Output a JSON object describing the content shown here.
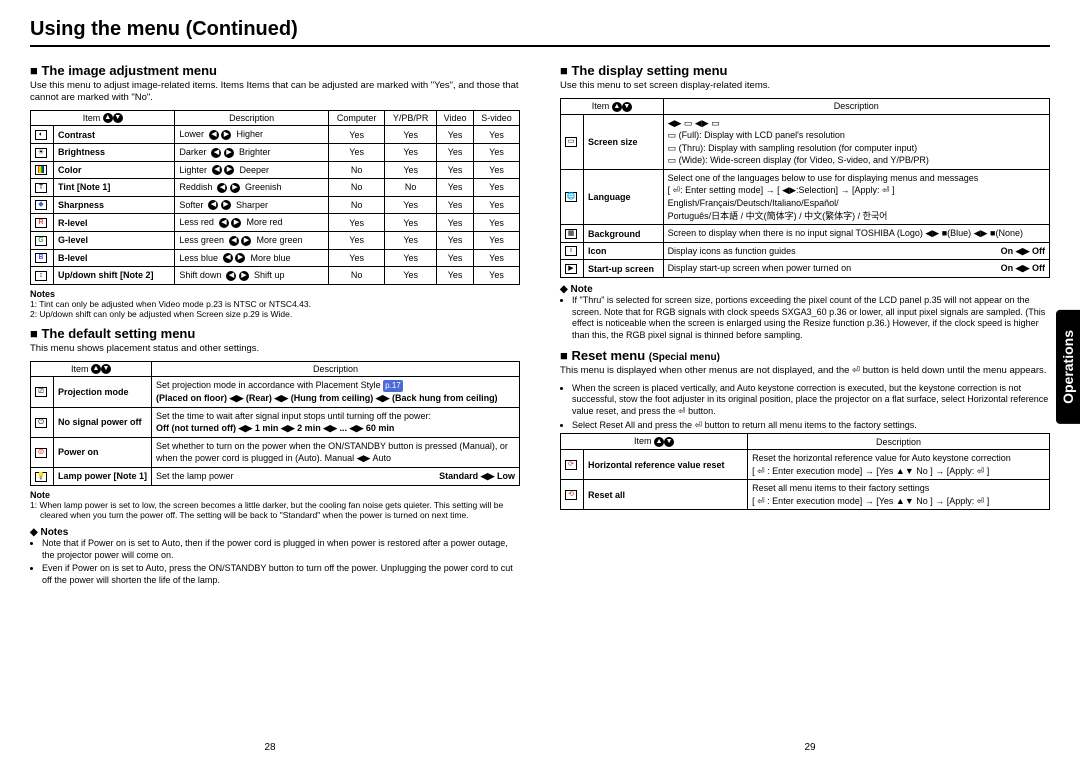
{
  "top_title": "Using the menu (Continued)",
  "left": {
    "image_menu": {
      "title": "■ The image adjustment menu",
      "intro": "Use this menu to adjust image-related items.\nItems Items that can be adjusted are marked with \"Yes\", and those that cannot are marked with \"No\".",
      "header": {
        "item": "Item",
        "desc": "Description",
        "c1": "Computer",
        "c2": "Y/PB/PR",
        "c3": "Video",
        "c4": "S-video"
      },
      "rows": [
        {
          "icon": "moon",
          "name": "Contrast",
          "left": "Lower",
          "right": "Higher",
          "c": [
            "Yes",
            "Yes",
            "Yes",
            "Yes"
          ]
        },
        {
          "icon": "sun",
          "name": "Brightness",
          "left": "Darker",
          "right": "Brighter",
          "c": [
            "Yes",
            "Yes",
            "Yes",
            "Yes"
          ]
        },
        {
          "icon": "pal",
          "name": "Color",
          "left": "Lighter",
          "right": "Deeper",
          "c": [
            "No",
            "Yes",
            "Yes",
            "Yes"
          ]
        },
        {
          "icon": "tint",
          "name": "Tint [Note 1]",
          "left": "Reddish",
          "right": "Greenish",
          "c": [
            "No",
            "No",
            "Yes",
            "Yes"
          ]
        },
        {
          "icon": "sharp",
          "name": "Sharpness",
          "left": "Softer",
          "right": "Sharper",
          "c": [
            "No",
            "Yes",
            "Yes",
            "Yes"
          ]
        },
        {
          "icon": "rl",
          "name": "R-level",
          "left": "Less red",
          "right": "More red",
          "c": [
            "Yes",
            "Yes",
            "Yes",
            "Yes"
          ]
        },
        {
          "icon": "gl",
          "name": "G-level",
          "left": "Less green",
          "right": "More green",
          "c": [
            "Yes",
            "Yes",
            "Yes",
            "Yes"
          ]
        },
        {
          "icon": "bl",
          "name": "B-level",
          "left": "Less blue",
          "right": "More blue",
          "c": [
            "Yes",
            "Yes",
            "Yes",
            "Yes"
          ]
        },
        {
          "icon": "ud",
          "name": "Up/down shift [Note 2]",
          "left": "Shift down",
          "right": "Shift up",
          "c": [
            "No",
            "Yes",
            "Yes",
            "Yes"
          ]
        }
      ],
      "notes_h": "Notes",
      "notes": [
        "1: Tint can only be adjusted when Video mode p.23 is NTSC or NTSC4.43.",
        "2: Up/down shift can only be adjusted when Screen size p.29 is Wide."
      ]
    },
    "default_menu": {
      "title": "■ The default setting menu",
      "intro": "This menu shows placement status and other settings.",
      "header": {
        "item": "Item",
        "desc": "Description"
      },
      "rows": [
        {
          "icon": "proj",
          "name": "Projection mode",
          "desc": "Set projection mode in accordance with Placement Style ",
          "pref": "p.17",
          "line2": "(Placed on floor) ◀▶ (Rear) ◀▶ (Hung from ceiling) ◀▶ (Back hung from ceiling)"
        },
        {
          "icon": "nosig",
          "name": "No signal power off",
          "desc": "Set the time to wait after signal input stops until turning off the power:",
          "line2": "Off (not turned off) ◀▶ 1 min ◀▶ 2 min ◀▶ ... ◀▶ 60 min"
        },
        {
          "icon": "pwr",
          "name": "Power on",
          "desc": "Set whether to turn on the power when the ON/STANDBY button is pressed (Manual), or when the power cord is plugged in (Auto).    Manual ◀▶ Auto"
        },
        {
          "icon": "lamp",
          "name": "Lamp power [Note 1]",
          "desc": "Set the lamp power",
          "right": "Standard ◀▶ Low"
        }
      ],
      "note_h": "Note",
      "note": "1: When lamp power is set to low, the screen becomes a little darker, but the cooling fan noise gets quieter. This setting will be cleared when you turn the power off. The setting will be back to \"Standard\" when the power is turned on next time.",
      "notes2_h": "◆ Notes",
      "notes2": [
        "Note that if Power on is set to Auto, then if the power cord is plugged in when power is restored after a power outage, the projector power will come on.",
        "Even if Power on is set to Auto, press the ON/STANDBY button to turn off the power. Unplugging the power cord to cut off the power will shorten the life of the lamp."
      ]
    },
    "page": "28"
  },
  "right": {
    "display_menu": {
      "title": "■ The display setting menu",
      "intro": "Use this menu to set screen display-related items.",
      "header": {
        "item": "Item",
        "desc": "Description"
      },
      "rows": [
        {
          "icon": "scr",
          "name": "Screen size",
          "desc_lines": [
            "▭ (Full):  Display with LCD panel's resolution",
            "▭ (Thru): Display with sampling resolution (for computer input)",
            "▭ (Wide):  Wide-screen display (for Video, S-video, and Y/PB/PR)"
          ],
          "top_icons": "◀▶ ▭ ◀▶ ▭"
        },
        {
          "icon": "lang",
          "name": "Language",
          "desc": "Select one of the languages below to use for displaying menus and messages",
          "line2": "[ ⏎: Enter setting mode] → [ ◀▶:Selection] → [Apply: ⏎ ]",
          "line3": "English/Français/Deutsch/Italiano/Español/",
          "line4": "Português/日本語 / 中文(簡体字) / 中文(繁体字) / 한국어"
        },
        {
          "icon": "bg",
          "name": "Background",
          "desc": "Screen to display when there is no input signal  TOSHIBA (Logo) ◀▶ ■(Blue) ◀▶ ■(None)"
        },
        {
          "icon": "icon",
          "name": "Icon",
          "desc": "Display icons as function guides",
          "right": "On ◀▶ Off"
        },
        {
          "icon": "start",
          "name": "Start-up screen",
          "desc": "Display start-up screen when power turned on",
          "right": "On ◀▶ Off"
        }
      ],
      "note_h": "◆ Note",
      "note": "If \"Thru\" is selected for screen size, portions exceeding the pixel count of the LCD panel p.35 will not appear on the screen. Note that for RGB signals with clock speeds SXGA3_60 p.36 or lower, all input pixel signals are sampled. (This effect is noticeable when the screen is enlarged using the Resize function p.36.) However, if the clock speed is higher than this, the RGB pixel signal is thinned before sampling."
    },
    "reset_menu": {
      "title": "■ Reset menu ",
      "title_small": "(Special menu)",
      "intro": "This menu is displayed when other menus are not displayed, and the ⏎ button is held down until the menu appears.",
      "bullets": [
        "When the screen is placed vertically, and Auto keystone correction is executed, but the keystone correction is not successful, stow the foot adjuster in its original position, place the projector on a flat surface, select Horizontal reference value reset, and press the ⏎ button.",
        "Select Reset All and press the ⏎ button to return all menu items to the factory settings."
      ],
      "header": {
        "item": "Item",
        "desc": "Description"
      },
      "rows": [
        {
          "icon": "hrz",
          "name": "Horizontal reference value reset",
          "desc": "Reset the horizontal reference value for Auto keystone correction",
          "line2": "[ ⏎ : Enter execution mode] → [Yes ▲▼ No ] → [Apply: ⏎ ]"
        },
        {
          "icon": "rst",
          "name": "Reset all",
          "desc": "Reset all menu items to their factory settings",
          "line2": "[ ⏎ : Enter execution mode] → [Yes ▲▼ No ] → [Apply: ⏎ ]"
        }
      ]
    },
    "page": "29"
  },
  "side_tab": "Operations"
}
